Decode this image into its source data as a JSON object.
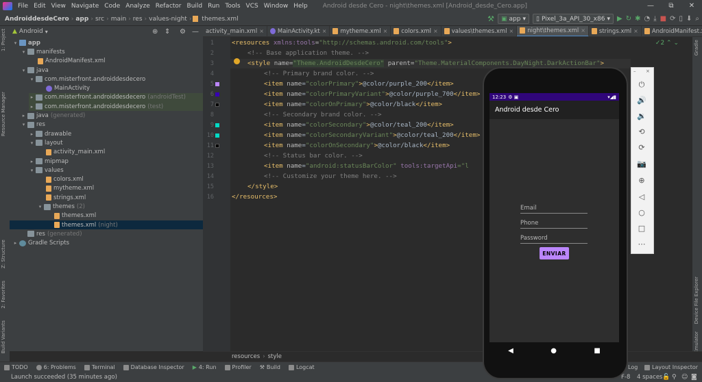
{
  "menu": {
    "items": [
      "File",
      "Edit",
      "View",
      "Navigate",
      "Code",
      "Analyze",
      "Refactor",
      "Build",
      "Run",
      "Tools",
      "VCS",
      "Window",
      "Help"
    ],
    "window_title": "Android desde Cero - night\\themes.xml [Android_desde_Cero.app]",
    "minimize": "—",
    "maximize": "⧉",
    "close": "✕"
  },
  "nav": {
    "crumbs": [
      "AndroiddesdeCero",
      "app",
      "src",
      "main",
      "res",
      "values-night",
      "themes.xml"
    ],
    "run_config": "app",
    "device": "Pixel_3a_API_30_x86"
  },
  "project": {
    "view_label": "Android",
    "tree": [
      {
        "label": "app",
        "dim": ""
      },
      {
        "label": "manifests",
        "dim": ""
      },
      {
        "label": "AndroidManifest.xml",
        "dim": ""
      },
      {
        "label": "java",
        "dim": ""
      },
      {
        "label": "com.misterfront.androiddesdecero",
        "dim": ""
      },
      {
        "label": "MainActivity",
        "dim": ""
      },
      {
        "label": "com.misterfront.androiddesdecero",
        "dim": "(androidTest)"
      },
      {
        "label": "com.misterfront.androiddesdecero",
        "dim": "(test)"
      },
      {
        "label": "java",
        "dim": "(generated)"
      },
      {
        "label": "res",
        "dim": ""
      },
      {
        "label": "drawable",
        "dim": ""
      },
      {
        "label": "layout",
        "dim": ""
      },
      {
        "label": "activity_main.xml",
        "dim": ""
      },
      {
        "label": "mipmap",
        "dim": ""
      },
      {
        "label": "values",
        "dim": ""
      },
      {
        "label": "colors.xml",
        "dim": ""
      },
      {
        "label": "mytheme.xml",
        "dim": ""
      },
      {
        "label": "strings.xml",
        "dim": ""
      },
      {
        "label": "themes",
        "dim": "(2)"
      },
      {
        "label": "themes.xml",
        "dim": ""
      },
      {
        "label": "themes.xml",
        "dim": "(night)"
      },
      {
        "label": "res",
        "dim": "(generated)"
      },
      {
        "label": "Gradle Scripts",
        "dim": ""
      }
    ]
  },
  "tabs": [
    "activity_main.xml",
    "MainActivity.kt",
    "mytheme.xml",
    "colors.xml",
    "values\\themes.xml",
    "night\\themes.xml",
    "strings.xml",
    "AndroidManifest.xml"
  ],
  "editor": {
    "line_numbers": [
      "1",
      "2",
      "3",
      "4",
      "5",
      "6",
      "7",
      "8",
      "9",
      "10",
      "11",
      "12",
      "13",
      "14",
      "15",
      "16"
    ],
    "inspection_count": "2",
    "lines": {
      "l1": {
        "open": "<resources ",
        "ns": "xmlns:",
        "attr": "tools",
        "eq": "=",
        "val": "\"http://schemas.android.com/tools\"",
        "close": ">"
      },
      "l2": "<!-- Base application theme. -->",
      "l3": {
        "open": "<style ",
        "attr1": "name",
        "eq": "=",
        "val1": "\"Theme.AndroidDesdeCero\"",
        "attr2": " parent",
        "val2": "\"Theme.MaterialComponents.DayNight.DarkActionBar\"",
        "close": ">"
      },
      "l4": "<!-- Primary brand color. -->",
      "l5": {
        "attr": "\"colorPrimary\"",
        "value": "@color/purple_200"
      },
      "l6": {
        "attr": "\"colorPrimaryVariant\"",
        "value": "@color/purple_700"
      },
      "l7": {
        "attr": "\"colorOnPrimary\"",
        "value": "@color/black"
      },
      "l8": "<!-- Secondary brand color. -->",
      "l9": {
        "attr": "\"colorSecondary\"",
        "value": "@color/teal_200"
      },
      "l10": {
        "attr": "\"colorSecondaryVariant\"",
        "value": "@color/teal_200"
      },
      "l11": {
        "attr": "\"colorOnSecondary\"",
        "value": "@color/black"
      },
      "l12": "<!-- Status bar color. -->",
      "l13": {
        "attr": "\"android:statusBarColor\"",
        "tools": " tools:targetApi",
        "value": "=\"l"
      },
      "l14": "<!-- Customize your theme here. -->",
      "l15": "</style>",
      "l16": "</resources>"
    },
    "item_open": "<item ",
    "item_name": "name",
    "item_close": "</item>",
    "swatch_colors": {
      "purple200": "#bb86fc",
      "purple700": "#3700b3",
      "black": "#000000",
      "teal200": "#03dac5"
    }
  },
  "breadcrumb": [
    "resources",
    "style"
  ],
  "tool_windows": [
    "TODO",
    "6: Problems",
    "Terminal",
    "Database Inspector",
    "4: Run",
    "Profiler",
    "Build",
    "Logcat"
  ],
  "tool_windows_right": [
    "Log",
    "Layout Inspector"
  ],
  "status": {
    "message": "Launch succeeded (35 minutes ago)",
    "encoding": "F-8",
    "indent": "4 spaces"
  },
  "stripe_labels": {
    "left": [
      "1: Project",
      "Resource Manager",
      "Z: Structure",
      "2: Favorites",
      "Build Variants"
    ],
    "right": [
      "Gradle",
      "Device File Explorer",
      "Emulator"
    ]
  },
  "phone": {
    "time": "12:23",
    "app_title": "Android desde Cero",
    "email_hint": "Email",
    "phone_hint": "Phone",
    "password_hint": "Password",
    "button": "ENVIAR",
    "nav_back": "◀",
    "nav_home": "●",
    "nav_recent": "■"
  },
  "emulator_controls": [
    "power-icon",
    "volume-up-icon",
    "volume-down-icon",
    "rotate-left-icon",
    "rotate-right-icon",
    "camera-icon",
    "zoom-icon",
    "back-icon",
    "home-icon",
    "overview-icon",
    "more-icon"
  ],
  "colors": {
    "accent": "#bb86fc",
    "status_bar": "#30067a"
  }
}
